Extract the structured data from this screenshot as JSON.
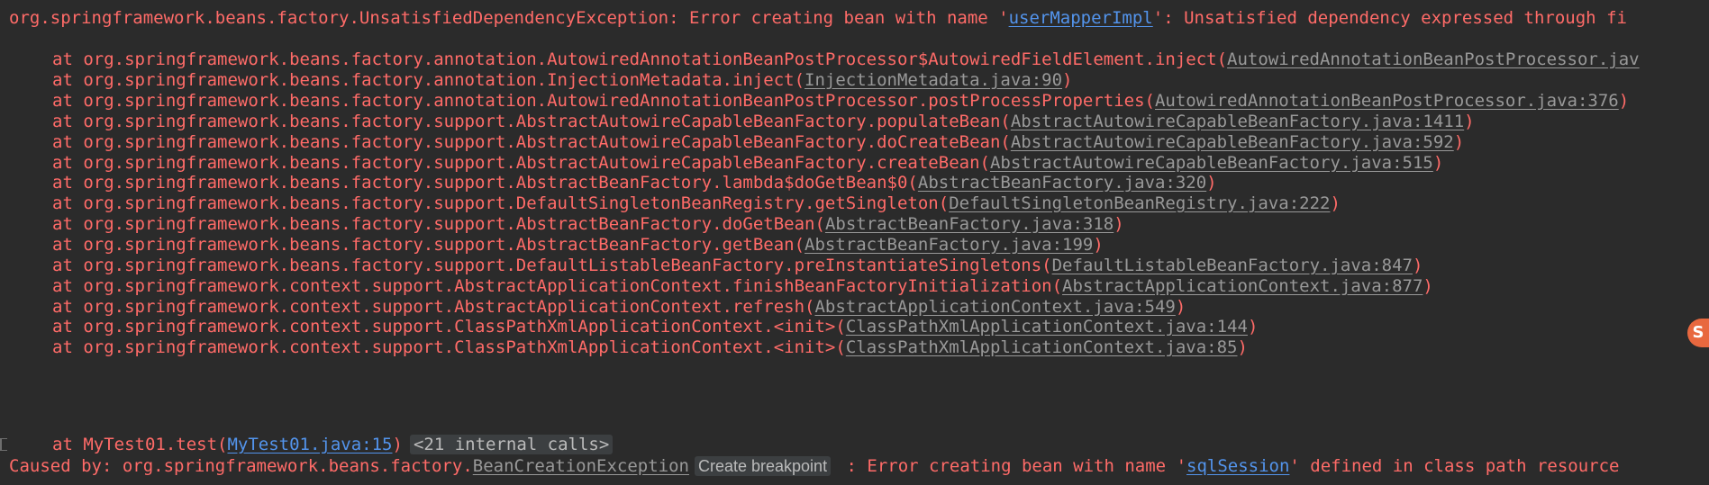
{
  "exception": {
    "prefix": "org.springframework.beans.factory.UnsatisfiedDependencyException: Error creating bean with name '",
    "bean": "userMapperImpl",
    "suffix": "': Unsatisfied dependency expressed through fi"
  },
  "frames": [
    {
      "text": "at org.springframework.beans.factory.annotation.AutowiredAnnotationBeanPostProcessor$AutowiredFieldElement.inject(",
      "link": "AutowiredAnnotationBeanPostProcessor.jav",
      "close": ""
    },
    {
      "text": "at org.springframework.beans.factory.annotation.InjectionMetadata.inject(",
      "link": "InjectionMetadata.java:90",
      "close": ")"
    },
    {
      "text": "at org.springframework.beans.factory.annotation.AutowiredAnnotationBeanPostProcessor.postProcessProperties(",
      "link": "AutowiredAnnotationBeanPostProcessor.java:376",
      "close": ")"
    },
    {
      "text": "at org.springframework.beans.factory.support.AbstractAutowireCapableBeanFactory.populateBean(",
      "link": "AbstractAutowireCapableBeanFactory.java:1411",
      "close": ")"
    },
    {
      "text": "at org.springframework.beans.factory.support.AbstractAutowireCapableBeanFactory.doCreateBean(",
      "link": "AbstractAutowireCapableBeanFactory.java:592",
      "close": ")"
    },
    {
      "text": "at org.springframework.beans.factory.support.AbstractAutowireCapableBeanFactory.createBean(",
      "link": "AbstractAutowireCapableBeanFactory.java:515",
      "close": ")"
    },
    {
      "text": "at org.springframework.beans.factory.support.AbstractBeanFactory.lambda$doGetBean$0(",
      "link": "AbstractBeanFactory.java:320",
      "close": ")"
    },
    {
      "text": "at org.springframework.beans.factory.support.DefaultSingletonBeanRegistry.getSingleton(",
      "link": "DefaultSingletonBeanRegistry.java:222",
      "close": ")"
    },
    {
      "text": "at org.springframework.beans.factory.support.AbstractBeanFactory.doGetBean(",
      "link": "AbstractBeanFactory.java:318",
      "close": ")"
    },
    {
      "text": "at org.springframework.beans.factory.support.AbstractBeanFactory.getBean(",
      "link": "AbstractBeanFactory.java:199",
      "close": ")"
    },
    {
      "text": "at org.springframework.beans.factory.support.DefaultListableBeanFactory.preInstantiateSingletons(",
      "link": "DefaultListableBeanFactory.java:847",
      "close": ")"
    },
    {
      "text": "at org.springframework.context.support.AbstractApplicationContext.finishBeanFactoryInitialization(",
      "link": "AbstractApplicationContext.java:877",
      "close": ")"
    },
    {
      "text": "at org.springframework.context.support.AbstractApplicationContext.refresh(",
      "link": "AbstractApplicationContext.java:549",
      "close": ")"
    },
    {
      "text": "at org.springframework.context.support.ClassPathXmlApplicationContext.<init>(",
      "link": "ClassPathXmlApplicationContext.java:144",
      "close": ")"
    },
    {
      "text": "at org.springframework.context.support.ClassPathXmlApplicationContext.<init>(",
      "link": "ClassPathXmlApplicationContext.java:85",
      "close": ")"
    }
  ],
  "test_frame": {
    "text": "at MyTest01.test(",
    "link": "MyTest01.java:15",
    "close": ")",
    "internal": "<21 internal calls>"
  },
  "caused_by": {
    "prefix": "Caused by: org.springframework.beans.factory.",
    "exception_link": "BeanCreationException",
    "breakpoint": "Create breakpoint",
    "middle": " : Error creating bean with name '",
    "bean": "sqlSession",
    "suffix": "' defined in class path resource"
  },
  "side_badge": "S",
  "colors": {
    "background": "#2b2b2b",
    "error_text": "#ff6b68",
    "file_link": "#999999",
    "class_link": "#5394ec"
  }
}
